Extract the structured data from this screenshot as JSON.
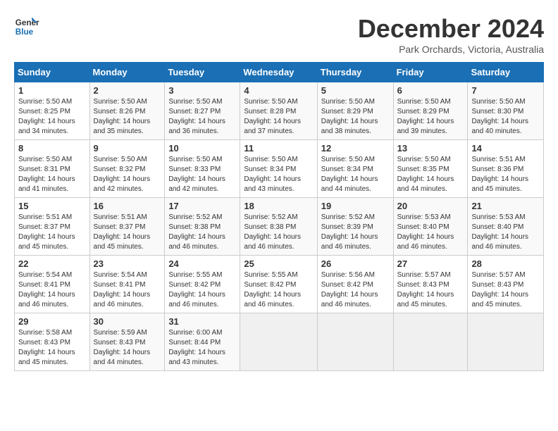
{
  "header": {
    "logo_line1": "General",
    "logo_line2": "Blue",
    "title": "December 2024",
    "subtitle": "Park Orchards, Victoria, Australia"
  },
  "calendar": {
    "days_of_week": [
      "Sunday",
      "Monday",
      "Tuesday",
      "Wednesday",
      "Thursday",
      "Friday",
      "Saturday"
    ],
    "weeks": [
      [
        {
          "day": "",
          "info": ""
        },
        {
          "day": "2",
          "info": "Sunrise: 5:50 AM\nSunset: 8:26 PM\nDaylight: 14 hours\nand 35 minutes."
        },
        {
          "day": "3",
          "info": "Sunrise: 5:50 AM\nSunset: 8:27 PM\nDaylight: 14 hours\nand 36 minutes."
        },
        {
          "day": "4",
          "info": "Sunrise: 5:50 AM\nSunset: 8:28 PM\nDaylight: 14 hours\nand 37 minutes."
        },
        {
          "day": "5",
          "info": "Sunrise: 5:50 AM\nSunset: 8:29 PM\nDaylight: 14 hours\nand 38 minutes."
        },
        {
          "day": "6",
          "info": "Sunrise: 5:50 AM\nSunset: 8:29 PM\nDaylight: 14 hours\nand 39 minutes."
        },
        {
          "day": "7",
          "info": "Sunrise: 5:50 AM\nSunset: 8:30 PM\nDaylight: 14 hours\nand 40 minutes."
        }
      ],
      [
        {
          "day": "1",
          "info": "Sunrise: 5:50 AM\nSunset: 8:25 PM\nDaylight: 14 hours\nand 34 minutes."
        },
        {
          "day": "",
          "info": ""
        },
        {
          "day": "",
          "info": ""
        },
        {
          "day": "",
          "info": ""
        },
        {
          "day": "",
          "info": ""
        },
        {
          "day": "",
          "info": ""
        },
        {
          "day": "",
          "info": ""
        }
      ],
      [
        {
          "day": "8",
          "info": "Sunrise: 5:50 AM\nSunset: 8:31 PM\nDaylight: 14 hours\nand 41 minutes."
        },
        {
          "day": "9",
          "info": "Sunrise: 5:50 AM\nSunset: 8:32 PM\nDaylight: 14 hours\nand 42 minutes."
        },
        {
          "day": "10",
          "info": "Sunrise: 5:50 AM\nSunset: 8:33 PM\nDaylight: 14 hours\nand 42 minutes."
        },
        {
          "day": "11",
          "info": "Sunrise: 5:50 AM\nSunset: 8:34 PM\nDaylight: 14 hours\nand 43 minutes."
        },
        {
          "day": "12",
          "info": "Sunrise: 5:50 AM\nSunset: 8:34 PM\nDaylight: 14 hours\nand 44 minutes."
        },
        {
          "day": "13",
          "info": "Sunrise: 5:50 AM\nSunset: 8:35 PM\nDaylight: 14 hours\nand 44 minutes."
        },
        {
          "day": "14",
          "info": "Sunrise: 5:51 AM\nSunset: 8:36 PM\nDaylight: 14 hours\nand 45 minutes."
        }
      ],
      [
        {
          "day": "15",
          "info": "Sunrise: 5:51 AM\nSunset: 8:37 PM\nDaylight: 14 hours\nand 45 minutes."
        },
        {
          "day": "16",
          "info": "Sunrise: 5:51 AM\nSunset: 8:37 PM\nDaylight: 14 hours\nand 45 minutes."
        },
        {
          "day": "17",
          "info": "Sunrise: 5:52 AM\nSunset: 8:38 PM\nDaylight: 14 hours\nand 46 minutes."
        },
        {
          "day": "18",
          "info": "Sunrise: 5:52 AM\nSunset: 8:38 PM\nDaylight: 14 hours\nand 46 minutes."
        },
        {
          "day": "19",
          "info": "Sunrise: 5:52 AM\nSunset: 8:39 PM\nDaylight: 14 hours\nand 46 minutes."
        },
        {
          "day": "20",
          "info": "Sunrise: 5:53 AM\nSunset: 8:40 PM\nDaylight: 14 hours\nand 46 minutes."
        },
        {
          "day": "21",
          "info": "Sunrise: 5:53 AM\nSunset: 8:40 PM\nDaylight: 14 hours\nand 46 minutes."
        }
      ],
      [
        {
          "day": "22",
          "info": "Sunrise: 5:54 AM\nSunset: 8:41 PM\nDaylight: 14 hours\nand 46 minutes."
        },
        {
          "day": "23",
          "info": "Sunrise: 5:54 AM\nSunset: 8:41 PM\nDaylight: 14 hours\nand 46 minutes."
        },
        {
          "day": "24",
          "info": "Sunrise: 5:55 AM\nSunset: 8:42 PM\nDaylight: 14 hours\nand 46 minutes."
        },
        {
          "day": "25",
          "info": "Sunrise: 5:55 AM\nSunset: 8:42 PM\nDaylight: 14 hours\nand 46 minutes."
        },
        {
          "day": "26",
          "info": "Sunrise: 5:56 AM\nSunset: 8:42 PM\nDaylight: 14 hours\nand 46 minutes."
        },
        {
          "day": "27",
          "info": "Sunrise: 5:57 AM\nSunset: 8:43 PM\nDaylight: 14 hours\nand 45 minutes."
        },
        {
          "day": "28",
          "info": "Sunrise: 5:57 AM\nSunset: 8:43 PM\nDaylight: 14 hours\nand 45 minutes."
        }
      ],
      [
        {
          "day": "29",
          "info": "Sunrise: 5:58 AM\nSunset: 8:43 PM\nDaylight: 14 hours\nand 45 minutes."
        },
        {
          "day": "30",
          "info": "Sunrise: 5:59 AM\nSunset: 8:43 PM\nDaylight: 14 hours\nand 44 minutes."
        },
        {
          "day": "31",
          "info": "Sunrise: 6:00 AM\nSunset: 8:44 PM\nDaylight: 14 hours\nand 43 minutes."
        },
        {
          "day": "",
          "info": ""
        },
        {
          "day": "",
          "info": ""
        },
        {
          "day": "",
          "info": ""
        },
        {
          "day": "",
          "info": ""
        }
      ]
    ]
  }
}
